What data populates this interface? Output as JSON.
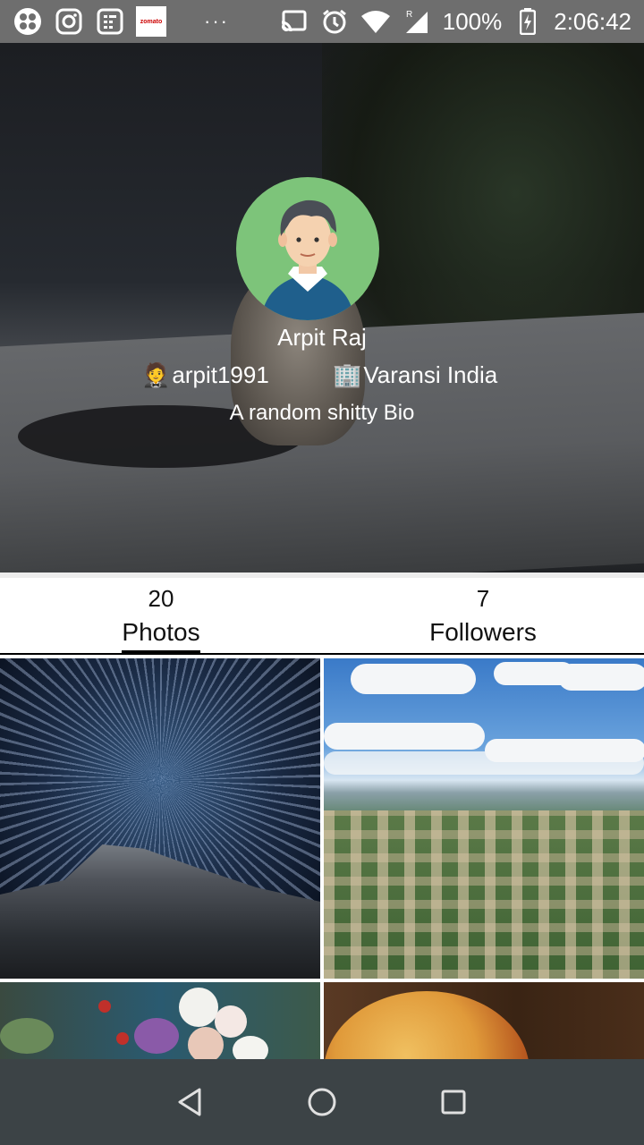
{
  "status_bar": {
    "apps": [
      "app-grid-icon",
      "instagram-icon",
      "calculator-icon",
      "zomato-icon"
    ],
    "zomato_label": "zomato",
    "more": "···",
    "battery": "100%",
    "time": "2:06:42"
  },
  "profile": {
    "name": "Arpit Raj",
    "user_emoji": "🤵",
    "username": "arpit1991",
    "location_emoji": "🏢",
    "location": "Varansi India",
    "bio": "A random shitty Bio"
  },
  "stats": {
    "photos_count": "20",
    "photos_label": "Photos",
    "followers_count": "7",
    "followers_label": "Followers"
  },
  "colors": {
    "avatar_bg": "#7dc47a",
    "status_bar": "#6e6e6e",
    "nav_bar": "#3c4346"
  }
}
